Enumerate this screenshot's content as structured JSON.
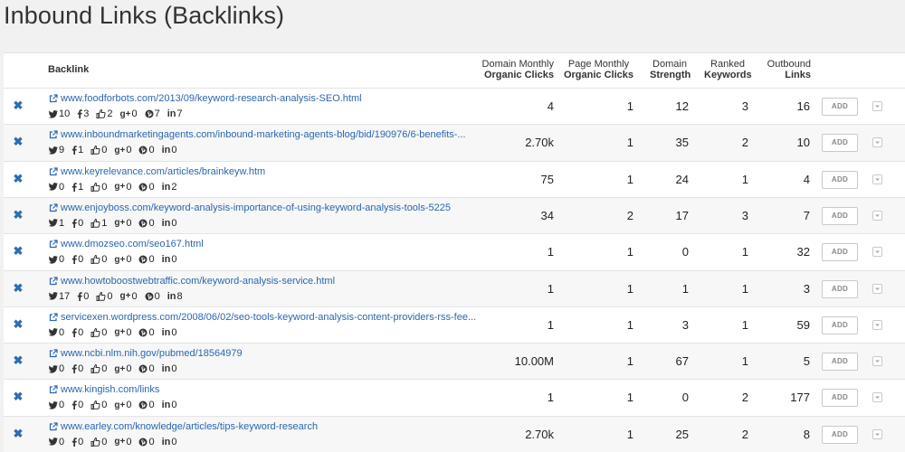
{
  "page": {
    "title": "Inbound Links (Backlinks)"
  },
  "table": {
    "headers": {
      "backlink": "Backlink",
      "domain_monthly_l1": "Domain Monthly",
      "domain_monthly_l2": "Organic Clicks",
      "page_monthly_l1": "Page Monthly",
      "page_monthly_l2": "Organic Clicks",
      "domain_strength_l1": "Domain",
      "domain_strength_l2": "Strength",
      "ranked_keywords_l1": "Ranked",
      "ranked_keywords_l2": "Keywords",
      "outbound_links_l1": "Outbound",
      "outbound_links_l2": "Links"
    },
    "add_label": "ADD",
    "remove_icon": "x-icon",
    "rows": [
      {
        "url": "www.foodforbots.com/2013/09/keyword-research-analysis-SEO.html",
        "twitter": "10",
        "facebook": "3",
        "like": "2",
        "gplus": "0",
        "pinterest": "7",
        "linkedin": "7",
        "domain_clicks": "4",
        "page_clicks": "1",
        "strength": "12",
        "keywords": "3",
        "outbound": "16"
      },
      {
        "url": "www.inboundmarketingagents.com/inbound-marketing-agents-blog/bid/190976/6-benefits-...",
        "twitter": "9",
        "facebook": "1",
        "like": "0",
        "gplus": "0",
        "pinterest": "0",
        "linkedin": "0",
        "domain_clicks": "2.70k",
        "page_clicks": "1",
        "strength": "35",
        "keywords": "2",
        "outbound": "10"
      },
      {
        "url": "www.keyrelevance.com/articles/brainkeyw.htm",
        "twitter": "0",
        "facebook": "1",
        "like": "0",
        "gplus": "0",
        "pinterest": "0",
        "linkedin": "2",
        "domain_clicks": "75",
        "page_clicks": "1",
        "strength": "24",
        "keywords": "1",
        "outbound": "4"
      },
      {
        "url": "www.enjoyboss.com/keyword-analysis-importance-of-using-keyword-analysis-tools-5225",
        "twitter": "1",
        "facebook": "0",
        "like": "1",
        "gplus": "0",
        "pinterest": "0",
        "linkedin": "0",
        "domain_clicks": "34",
        "page_clicks": "2",
        "strength": "17",
        "keywords": "3",
        "outbound": "7"
      },
      {
        "url": "www.dmozseo.com/seo167.html",
        "twitter": "0",
        "facebook": "0",
        "like": "0",
        "gplus": "0",
        "pinterest": "0",
        "linkedin": "0",
        "domain_clicks": "1",
        "page_clicks": "1",
        "strength": "0",
        "keywords": "1",
        "outbound": "32"
      },
      {
        "url": "www.howtoboostwebtraffic.com/keyword-analysis-service.html",
        "twitter": "17",
        "facebook": "0",
        "like": "0",
        "gplus": "0",
        "pinterest": "0",
        "linkedin": "8",
        "domain_clicks": "1",
        "page_clicks": "1",
        "strength": "1",
        "keywords": "1",
        "outbound": "3"
      },
      {
        "url": "servicexen.wordpress.com/2008/06/02/seo-tools-keyword-analysis-content-providers-rss-fee...",
        "twitter": "0",
        "facebook": "0",
        "like": "0",
        "gplus": "0",
        "pinterest": "0",
        "linkedin": "0",
        "domain_clicks": "1",
        "page_clicks": "1",
        "strength": "3",
        "keywords": "1",
        "outbound": "59"
      },
      {
        "url": "www.ncbi.nlm.nih.gov/pubmed/18564979",
        "twitter": "0",
        "facebook": "0",
        "like": "0",
        "gplus": "0",
        "pinterest": "0",
        "linkedin": "0",
        "domain_clicks": "10.00M",
        "page_clicks": "1",
        "strength": "67",
        "keywords": "1",
        "outbound": "5"
      },
      {
        "url": "www.kingish.com/links",
        "twitter": "0",
        "facebook": "0",
        "like": "0",
        "gplus": "0",
        "pinterest": "0",
        "linkedin": "0",
        "domain_clicks": "1",
        "page_clicks": "1",
        "strength": "0",
        "keywords": "2",
        "outbound": "177"
      },
      {
        "url": "www.earley.com/knowledge/articles/tips-keyword-research",
        "twitter": "0",
        "facebook": "0",
        "like": "0",
        "gplus": "0",
        "pinterest": "0",
        "linkedin": "0",
        "domain_clicks": "2.70k",
        "page_clicks": "1",
        "strength": "25",
        "keywords": "2",
        "outbound": "8"
      }
    ]
  }
}
